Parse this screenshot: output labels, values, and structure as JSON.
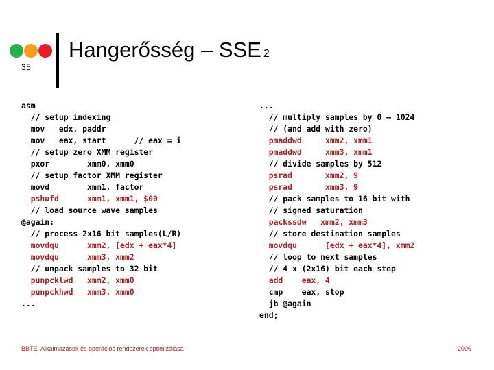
{
  "slide": {
    "number": "35",
    "title_main": "Hangerősség – SSE",
    "title_sub": "2"
  },
  "colors": {
    "dot_green": "#22B14C",
    "dot_orange": "#F9A01B",
    "dot_red": "#ED1C24",
    "rule": "#000000",
    "mnemonic_red": "#AF1F23",
    "comment_black": "#000000",
    "footer_red": "#AF1F23"
  },
  "header": {
    "dots": [
      {
        "name": "green-dot",
        "color": "#22B14C"
      },
      {
        "name": "orange-dot",
        "color": "#F9A01B"
      },
      {
        "name": "red-dot",
        "color": "#ED1C24"
      }
    ]
  },
  "code": {
    "left_column": [
      [
        {
          "t": "asm",
          "c": "plain"
        }
      ],
      [
        {
          "t": "  // setup indexing",
          "c": "comment"
        }
      ],
      [
        {
          "t": "  mov   edx, paddr",
          "c": "plain"
        }
      ],
      [
        {
          "t": "  mov   eax, start      // eax = i",
          "c": "plain"
        }
      ],
      [
        {
          "t": "  // setup zero XMM register",
          "c": "comment"
        }
      ],
      [
        {
          "t": "  pxor        xmm0, xmm0",
          "c": "plain"
        }
      ],
      [
        {
          "t": "  // setup factor XMM register",
          "c": "comment"
        }
      ],
      [
        {
          "t": "  movd        xmm1, factor",
          "c": "plain"
        }
      ],
      [
        {
          "t": "  pshufd      xmm1, xmm1, $00",
          "c": "mn"
        }
      ],
      [
        {
          "t": "  // load source wave samples",
          "c": "comment"
        }
      ],
      [
        {
          "t": "@again:",
          "c": "plain"
        }
      ],
      [
        {
          "t": "  // process 2x16 bit samples(L/R)",
          "c": "comment"
        }
      ],
      [
        {
          "t": "  movdqu      xmm2, [edx + eax*4]",
          "c": "mn"
        }
      ],
      [
        {
          "t": "  movdqu      xmm3, xmm2",
          "c": "mn"
        }
      ],
      [
        {
          "t": "  // unpack samples to 32 bit",
          "c": "comment"
        }
      ],
      [
        {
          "t": "  punpcklwd   xmm2, xmm0",
          "c": "mn"
        }
      ],
      [
        {
          "t": "  punpckhwd   xmm3, xmm0",
          "c": "mn"
        }
      ],
      [
        {
          "t": "...",
          "c": "plain"
        }
      ]
    ],
    "right_column": [
      [
        {
          "t": "...",
          "c": "plain"
        }
      ],
      [
        {
          "t": "  // multiply samples by 0 – 1024",
          "c": "comment"
        }
      ],
      [
        {
          "t": "  // (and add with zero)",
          "c": "comment"
        }
      ],
      [
        {
          "t": "  pmaddwd     xmm2, xmm1",
          "c": "mn"
        }
      ],
      [
        {
          "t": "  pmaddwd     xmm3, xmm1",
          "c": "mn"
        }
      ],
      [
        {
          "t": "  // divide samples by 512",
          "c": "comment"
        }
      ],
      [
        {
          "t": "  psrad       xmm2, 9",
          "c": "mn"
        }
      ],
      [
        {
          "t": "  psrad       xmm3, 9",
          "c": "mn"
        }
      ],
      [
        {
          "t": "  // pack samples to 16 bit with",
          "c": "comment"
        }
      ],
      [
        {
          "t": "  // signed saturation",
          "c": "comment"
        }
      ],
      [
        {
          "t": "  packssdw   xmm2, xmm3",
          "c": "mn"
        }
      ],
      [
        {
          "t": "  // store destination samples",
          "c": "comment"
        }
      ],
      [
        {
          "t": "  movdqu      [edx + eax*4], xmm2",
          "c": "mn"
        }
      ],
      [
        {
          "t": "  // loop to next samples",
          "c": "comment"
        }
      ],
      [
        {
          "t": "  // 4 x (2x16) bit each step",
          "c": "comment"
        }
      ],
      [
        {
          "t": "  add    eax, 4",
          "c": "mn"
        }
      ],
      [
        {
          "t": "  cmp    eax, stop",
          "c": "plain"
        }
      ],
      [
        {
          "t": "  jb @again",
          "c": "plain"
        }
      ],
      [
        {
          "t": "end;",
          "c": "plain"
        }
      ]
    ]
  },
  "footer": {
    "text": "BBTE, Alkalmazások és operációs rendszerek optimizálása",
    "year": "2006"
  }
}
